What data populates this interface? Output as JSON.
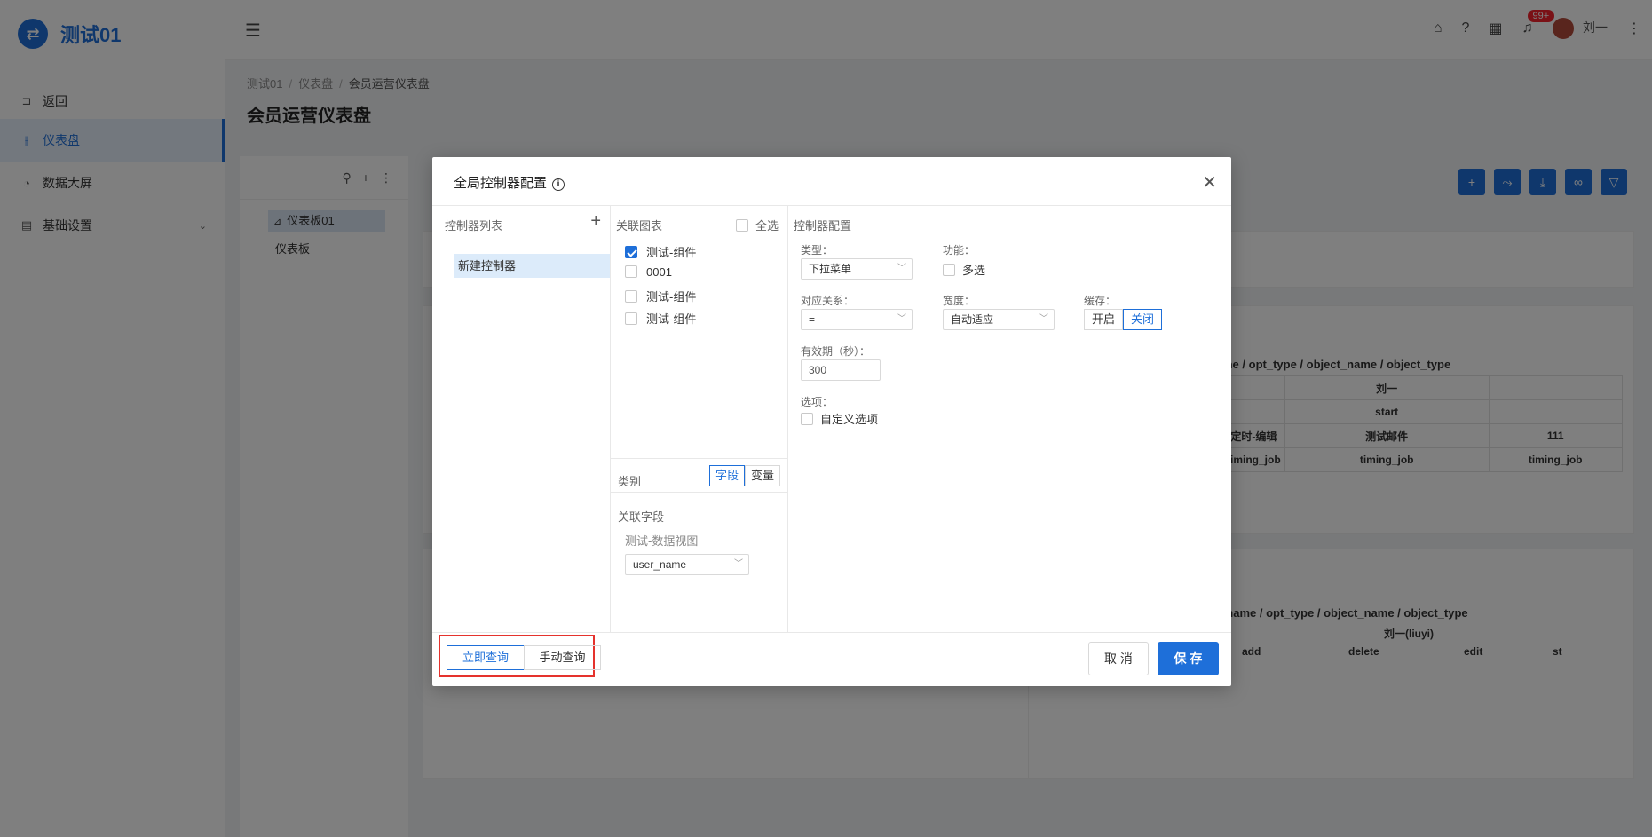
{
  "app": {
    "logo_glyph": "⇄",
    "title": "测试01",
    "accent": "#1e6fd9"
  },
  "sidebar": {
    "items": [
      {
        "label": "返回",
        "icon": "return-icon"
      },
      {
        "label": "仪表盘",
        "icon": "dashboard-icon",
        "active": true
      },
      {
        "label": "数据大屏",
        "icon": "screen-icon"
      },
      {
        "label": "基础设置",
        "icon": "settings-icon",
        "expandable": true
      }
    ]
  },
  "header": {
    "notification_badge": "99+",
    "user_name": "刘一"
  },
  "breadcrumb": [
    "测试01",
    "仪表盘",
    "会员运营仪表盘"
  ],
  "page_title": "会员运营仪表盘",
  "tree": {
    "nodes": [
      {
        "label": "仪表板01",
        "selected": true
      },
      {
        "label": "仪表板"
      }
    ]
  },
  "background_chart1": {
    "title": "me / opt_type / object_name / object_type",
    "rows": [
      [
        "",
        "刘一",
        "",
        ""
      ],
      [
        "",
        "start",
        "",
        ""
      ],
      [
        "定时-编辑",
        "",
        "测试邮件",
        "111"
      ],
      [
        "timing_job",
        "",
        "timing_job",
        "timing_job"
      ]
    ]
  },
  "background_chart2": {
    "title": "r_name / opt_type / object_name / object_type",
    "subtitle": "刘一(liuyi)",
    "columns": [
      "add",
      "delete",
      "edit",
      "st"
    ]
  },
  "modal": {
    "title": "全局控制器配置",
    "controller_list_title": "控制器列表",
    "controllers": [
      "新建控制器"
    ],
    "related_charts_title": "关联图表",
    "select_all_label": "全选",
    "charts": [
      {
        "label": "测试-组件",
        "checked": true
      },
      {
        "label": "0001",
        "checked": false
      },
      {
        "label": "测试-组件",
        "checked": false
      },
      {
        "label": "测试-组件",
        "checked": false
      }
    ],
    "category_label": "类别",
    "category_options": [
      "字段",
      "变量"
    ],
    "category_selected": "字段",
    "related_field_title": "关联字段",
    "dataview_name": "测试-数据视图",
    "field_value": "user_name",
    "config_title": "控制器配置",
    "type_label": "类型：",
    "type_value": "下拉菜单",
    "function_label": "功能：",
    "multi_select_label": "多选",
    "relation_label": "对应关系：",
    "relation_value": "=",
    "width_label": "宽度：",
    "width_value": "自动适应",
    "cache_label": "缓存：",
    "cache_on": "开启",
    "cache_off": "关闭",
    "validity_label": "有效期（秒）：",
    "validity_value": "300",
    "options_label": "选项：",
    "custom_options_label": "自定义选项",
    "query_immediate": "立即查询",
    "query_manual": "手动查询",
    "cancel": "取 消",
    "save": "保 存"
  }
}
